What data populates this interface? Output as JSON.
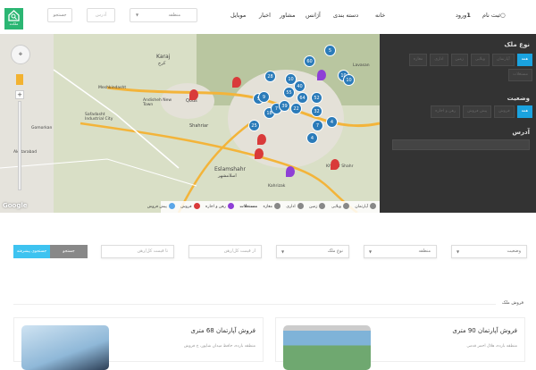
{
  "header": {
    "logo_text": "ملکده",
    "search_button": "جستجو",
    "address_placeholder": "آدرس",
    "region_select": "منطقه",
    "nav": [
      "خانه",
      "دسته بندی",
      "آژانس",
      "مشاور",
      "اخبار",
      "موبایل"
    ],
    "login": "ورود",
    "register": "ثبت نام"
  },
  "map": {
    "labels": [
      "Karaj",
      "کرج",
      "Meshkindasht",
      "Andisheh New Town",
      "Safadasht Industrial City",
      "Gomorkan",
      "Shahriar",
      "Qods",
      "Eslamshahr",
      "اسلامشهر",
      "Akhtarabad",
      "Kahrizak",
      "Khavar Shahr",
      "Lavasan"
    ],
    "clusters": [
      "5",
      "10",
      "9",
      "18",
      "7",
      "28",
      "10",
      "40",
      "55",
      "64",
      "22",
      "52",
      "32",
      "10",
      "60",
      "7",
      "4",
      "4",
      "25",
      "39",
      "5"
    ],
    "google": "Google"
  },
  "legend": [
    "آپارتمان",
    "ویلایی",
    "زمین",
    "اداری",
    "مغازه",
    "مستغلات",
    "رهن و اجاره",
    "فروش",
    "پیش فروش"
  ],
  "legend_colors": {
    "rent": "#8e3fd6",
    "sale": "#d93a3a",
    "presale": "#5aa6e8"
  },
  "panel": {
    "type_title": "نوع ملک",
    "types": [
      "همه",
      "آپارتمان",
      "ویلایی",
      "زمین",
      "اداری",
      "مغازه",
      "مستغلات"
    ],
    "status_title": "وضعیت",
    "statuses": [
      "همه",
      "فروش",
      "پیش فروش",
      "رهن و اجاره"
    ],
    "address_title": "آدرس"
  },
  "filters": {
    "status": "وضعیت",
    "region": "منطقه",
    "type": "نوع ملک",
    "price_from": "از قیمت کل/رهن",
    "price_to": "تا قیمت کل/رهن",
    "search": "جستجو",
    "advanced": "جستجوی پیشرفته"
  },
  "section": {
    "title": "فروش ملک"
  },
  "cards": [
    {
      "title": "فروش آپارتمان 90 متری",
      "subtitle": "منطقه بارده، هلال احمر قدمی"
    },
    {
      "title": "فروش آپارتمان 68 متری",
      "subtitle": "منطقه بارده، حافظ میدان شاپور، خ فروش"
    }
  ],
  "colors": {
    "accent": "#1aa3e0",
    "logo": "#2bb673",
    "panel": "#333333",
    "cluster": "#2b7bb9"
  }
}
